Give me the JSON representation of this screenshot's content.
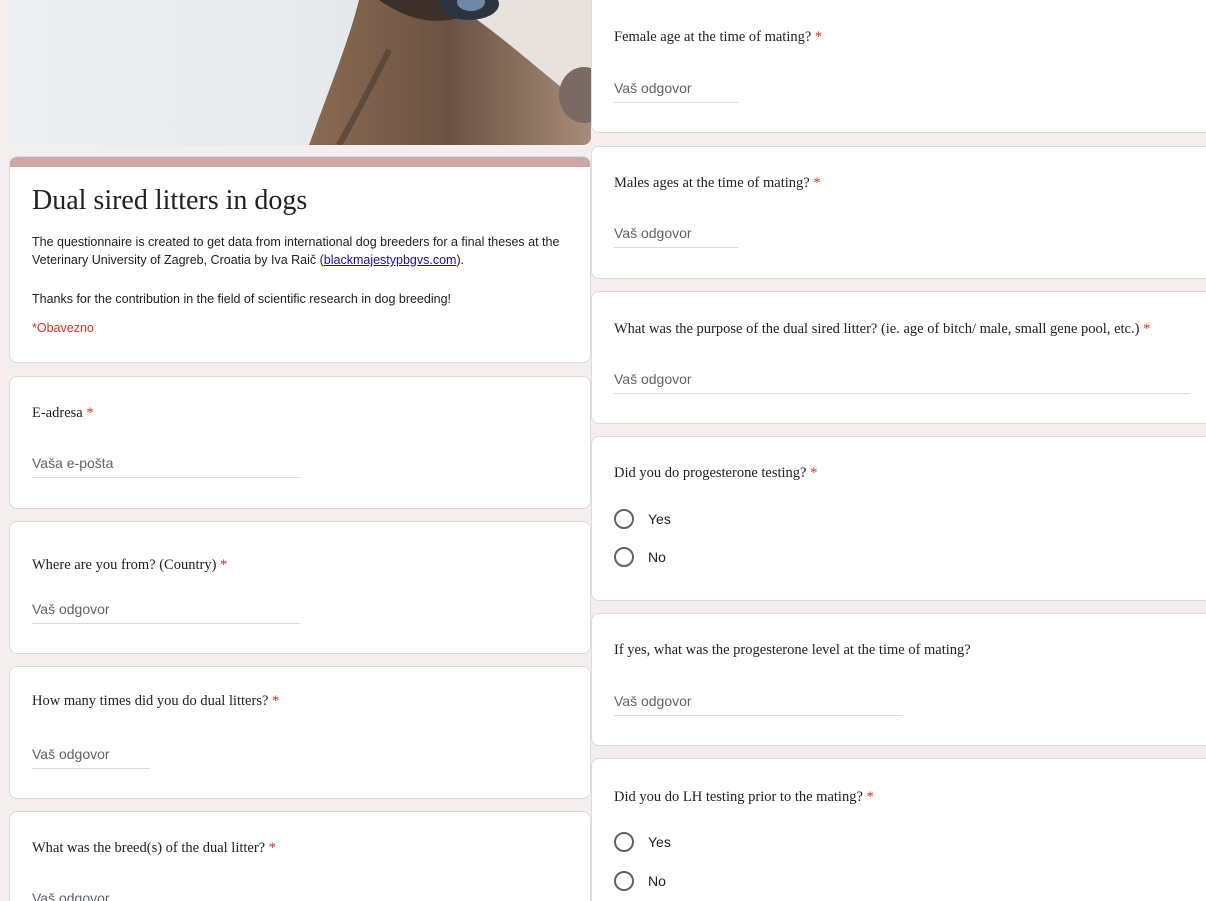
{
  "form": {
    "title": "Dual sired litters in dogs",
    "description_part1": "The questionnaire is created to get data from international dog breeders for a final theses at the Veterinary University of Zagreb, Croatia by Iva Raič (",
    "description_link": "blackmajestypbgvs.com",
    "description_part2": ").",
    "thanks": "Thanks for the contribution in the field of scientific research in dog breeding!",
    "required_note": "*Obavezno"
  },
  "questions_left": [
    {
      "title": "E-adresa",
      "required": "*",
      "placeholder": "Vaša e-pošta"
    },
    {
      "title": "Where are you from? (Country)",
      "required": "*",
      "placeholder": "Vaš odgovor"
    },
    {
      "title": "How many times did you do dual litters?",
      "required": "*",
      "placeholder": "Vaš odgovor"
    },
    {
      "title": "What was the breed(s) of the dual litter?",
      "required": "*",
      "placeholder": "Vaš odgovor"
    }
  ],
  "questions_right": [
    {
      "title": "Female age at the time of mating?",
      "required": "*",
      "placeholder": "Vaš odgovor"
    },
    {
      "title": "Males ages at the time of mating?",
      "required": "*",
      "placeholder": "Vaš odgovor"
    },
    {
      "title": "What was the purpose of the dual sired litter? (ie. age of bitch/ male, small gene pool, etc.)",
      "required": "*",
      "placeholder": "Vaš odgovor"
    },
    {
      "title": "Did you do progesterone testing?",
      "required": "*",
      "options": [
        "Yes",
        "No"
      ]
    },
    {
      "title": "If yes, what was the progesterone level at the time of mating?",
      "required": "",
      "placeholder": "Vaš odgovor"
    },
    {
      "title": "Did you do LH testing prior to the mating?",
      "required": "*",
      "options": [
        "Yes",
        "No"
      ]
    }
  ],
  "colors": {
    "accent": "#cda6a6",
    "required": "#d93025",
    "link": "#1a0dab",
    "background": "#f4eeee"
  }
}
